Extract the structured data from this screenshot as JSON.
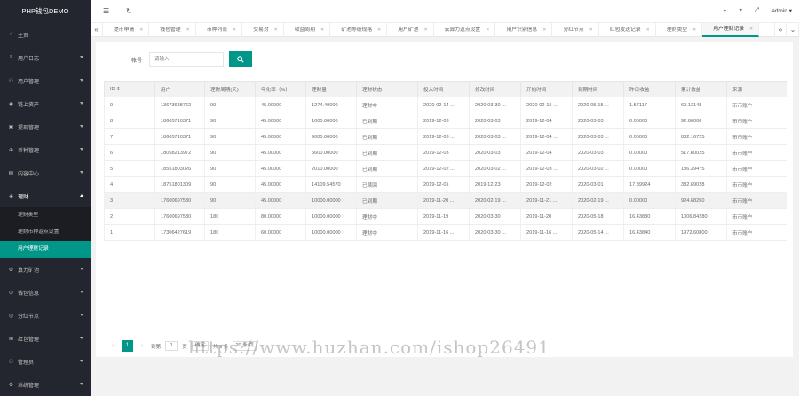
{
  "app": {
    "title": "PHP钱包DEMO"
  },
  "sidebar": {
    "items": [
      {
        "label": "主页",
        "icon": "home-icon",
        "glyph": "⌂",
        "arrow": false
      },
      {
        "label": "用户日志",
        "icon": "log-icon",
        "glyph": "≡",
        "arrow": true
      },
      {
        "label": "用户管理",
        "icon": "user-icon",
        "glyph": "⚇",
        "arrow": true
      },
      {
        "label": "链上资产",
        "icon": "asset-icon",
        "glyph": "◉",
        "arrow": true
      },
      {
        "label": "提现管理",
        "icon": "withdraw-icon",
        "glyph": "▣",
        "arrow": true
      },
      {
        "label": "币种管理",
        "icon": "coin-icon",
        "glyph": "⊕",
        "arrow": true
      },
      {
        "label": "内容中心",
        "icon": "content-icon",
        "glyph": "▤",
        "arrow": true
      },
      {
        "label": "理财",
        "icon": "finance-icon",
        "glyph": "◈",
        "arrow": true,
        "open": true
      }
    ],
    "sub_items": [
      {
        "label": "理财类型",
        "active": false
      },
      {
        "label": "理财币种返点设置",
        "active": false
      },
      {
        "label": "用户理财记录",
        "active": true
      }
    ],
    "items_after": [
      {
        "label": "算力矿池",
        "icon": "mining-icon",
        "glyph": "⚙",
        "arrow": true
      },
      {
        "label": "钱包信息",
        "icon": "wallet-icon",
        "glyph": "⊙",
        "arrow": true
      },
      {
        "label": "分红节点",
        "icon": "node-icon",
        "glyph": "◎",
        "arrow": true
      },
      {
        "label": "红包管理",
        "icon": "redpacket-icon",
        "glyph": "⊞",
        "arrow": true
      },
      {
        "label": "管理员",
        "icon": "admin-icon",
        "glyph": "⚇",
        "arrow": true
      },
      {
        "label": "系统管理",
        "icon": "system-icon",
        "glyph": "⚙",
        "arrow": true
      }
    ]
  },
  "header": {
    "user": "admin",
    "user_caret": "▾"
  },
  "tabs": [
    {
      "label": "提币申请"
    },
    {
      "label": "钱包管理"
    },
    {
      "label": "币种列表"
    },
    {
      "label": "交易对"
    },
    {
      "label": "收益周期"
    },
    {
      "label": "矿池等级规格"
    },
    {
      "label": "用户矿池"
    },
    {
      "label": "云算力返点设置"
    },
    {
      "label": "用户识别信息"
    },
    {
      "label": "分红节点"
    },
    {
      "label": "红包发送记录"
    },
    {
      "label": "理财类型"
    },
    {
      "label": "用户理财记录",
      "active": true
    }
  ],
  "search": {
    "label": "帐号",
    "placeholder": "请输入"
  },
  "table": {
    "headers": [
      "ID ⇕",
      "用户",
      "理财周期(天)",
      "年化率（%）",
      "理财量",
      "理财状态",
      "投入时间",
      "修改时间",
      "开始时间",
      "到期时间",
      "昨日收益",
      "累计收益",
      "来源"
    ],
    "rows": [
      [
        "9",
        "13673688762",
        "90",
        "45.00000",
        "1274.40000",
        "理财中",
        "2020-02-14 ...",
        "2020-03-30 ...",
        "2020-02-15 ...",
        "2020-05-15 ...",
        "1.57117",
        "69.13148",
        "币币账户"
      ],
      [
        "8",
        "18605710371",
        "90",
        "45.00000",
        "1000.00000",
        "已到期",
        "2019-12-03",
        "2020-03-03",
        "2019-12-04",
        "2020-03-03",
        "0.00000",
        "92.60000",
        "币币账户"
      ],
      [
        "7",
        "18605710371",
        "90",
        "45.00000",
        "9000.00000",
        "已到期",
        "2019-12-03 ...",
        "2020-03-03 ...",
        "2019-12-04 ...",
        "2020-03-03 ...",
        "0.00000",
        "832.16725",
        "币币账户"
      ],
      [
        "6",
        "18058213972",
        "90",
        "45.00000",
        "5600.00000",
        "已到期",
        "2019-12-03",
        "2020-03-03",
        "2019-12-04",
        "2020-03-03",
        "0.00000",
        "517.80025",
        "币币账户"
      ],
      [
        "5",
        "18551803026",
        "90",
        "45.00000",
        "2010.00000",
        "已到期",
        "2019-12-02 ...",
        "2020-03-02 ...",
        "2019-12-03 ...",
        "2020-03-02 ...",
        "0.00000",
        "186.39475",
        "币币账户"
      ],
      [
        "4",
        "18751801309",
        "90",
        "45.00000",
        "14109.54570",
        "已赎回",
        "2019-12-01",
        "2019-12-23",
        "2019-12-02",
        "2020-03-01",
        "17.39924",
        "382.69028",
        "币币账户"
      ],
      [
        "3",
        "17600697580",
        "90",
        "45.00000",
        "10000.00000",
        "已到期",
        "2019-11-20 ...",
        "2020-02-19 ...",
        "2019-11-21 ...",
        "2020-02-19 ...",
        "0.00000",
        "924.68250",
        "币币账户"
      ],
      [
        "2",
        "17600697580",
        "180",
        "80.00000",
        "10000.00000",
        "理财中",
        "2019-11-19",
        "2020-03-30",
        "2019-11-20",
        "2020-05-18",
        "16.43830",
        "1006.84280",
        "币币账户"
      ],
      [
        "1",
        "17306427619",
        "180",
        "60.00000",
        "10000.00000",
        "理财中",
        "2019-11-16 ...",
        "2020-03-30 ...",
        "2019-11-16 ...",
        "2020-05-14 ...",
        "16.43840",
        "1972.60800",
        "币币账户"
      ]
    ],
    "highlight_row": 6
  },
  "pager": {
    "prev": "‹",
    "current": "1",
    "next": "›",
    "goto_label": "到第",
    "goto_value": "1",
    "page_unit": "页",
    "confirm": "确定",
    "total": "共 9 条",
    "per_page": "20 条/页"
  },
  "watermark": "https://www.huzhan.com/ishop26491",
  "colors": {
    "accent": "#009688",
    "sidebar_bg": "#23262e"
  }
}
